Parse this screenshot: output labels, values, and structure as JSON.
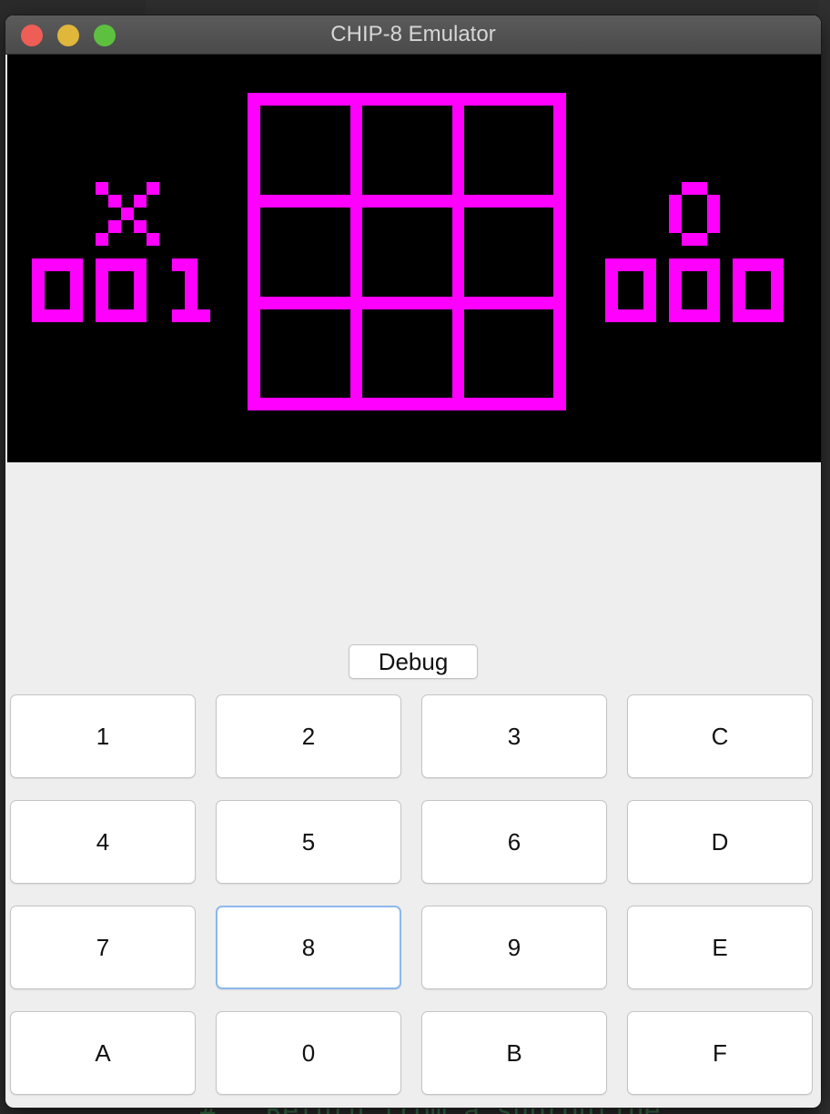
{
  "window": {
    "title": "CHIP-8 Emulator"
  },
  "display": {
    "background": "#000000",
    "pixel_color": "#ff00ff",
    "player_x_mark": "X",
    "player_x_score": "001",
    "player_o_mark": "O",
    "player_o_score": "000"
  },
  "debug_button": {
    "label": "Debug"
  },
  "keypad": {
    "rows": [
      [
        "1",
        "2",
        "3",
        "C"
      ],
      [
        "4",
        "5",
        "6",
        "D"
      ],
      [
        "7",
        "8",
        "9",
        "E"
      ],
      [
        "A",
        "0",
        "B",
        "F"
      ]
    ],
    "focused_key": "8"
  },
  "colors": {
    "window_background": "#eeeeee",
    "focus_ring": "#8cb8ec",
    "close": "#ee5e56",
    "minimize": "#e0b63b",
    "zoom": "#5ec03f"
  }
}
